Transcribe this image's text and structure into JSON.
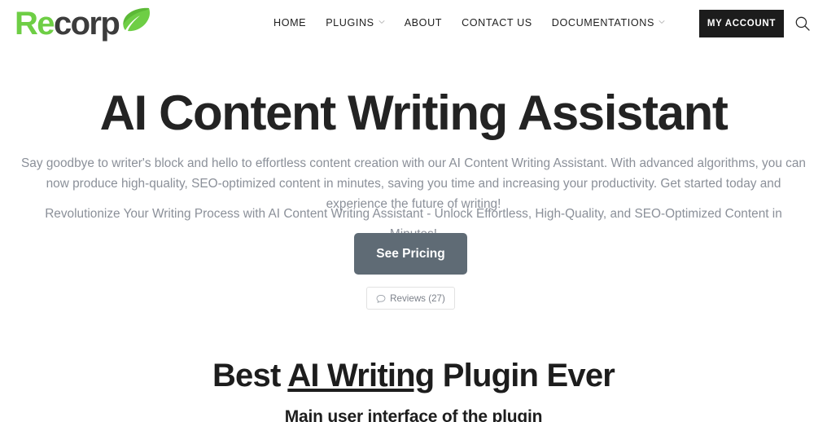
{
  "header": {
    "logo": {
      "part1": "Re",
      "part2": "corp",
      "leaf_icon": "leaf-icon"
    },
    "nav": [
      {
        "label": "HOME",
        "has_chevron": false
      },
      {
        "label": "PLUGINS",
        "has_chevron": true
      },
      {
        "label": "ABOUT",
        "has_chevron": false
      },
      {
        "label": "CONTACT US",
        "has_chevron": false
      },
      {
        "label": "DOCUMENTATIONS",
        "has_chevron": true
      }
    ],
    "account_button": "MY ACCOUNT",
    "search_icon": "search-icon"
  },
  "hero": {
    "title": "AI Content Writing Assistant",
    "paragraph1": "Say goodbye to writer's block and hello to effortless content creation with our AI Content Writing Assistant. With advanced algorithms, you can now produce high-quality, SEO-optimized content in minutes, saving you time and increasing your productivity. Get started today and experience the future of writing!",
    "paragraph2": "Revolutionize Your Writing Process with AI Content Writing Assistant - Unlock Effortless, High-Quality, and SEO-Optimized Content in Minutes!",
    "pricing_button": "See Pricing",
    "reviews_button": "Reviews (27)",
    "reviews_icon": "comment-bubble-icon"
  },
  "section": {
    "title_before": "Best ",
    "title_underlined": "AI Writing",
    "title_after": " Plugin Ever",
    "subtitle": "Main user interface of the plugin"
  },
  "colors": {
    "brand_green": "#6ECE45",
    "logo_dark": "#3c3c3c",
    "account_button_bg": "#1c1c1c",
    "pricing_button_bg": "#5f6b75",
    "body_text": "#8b9099",
    "heading": "#232323"
  }
}
